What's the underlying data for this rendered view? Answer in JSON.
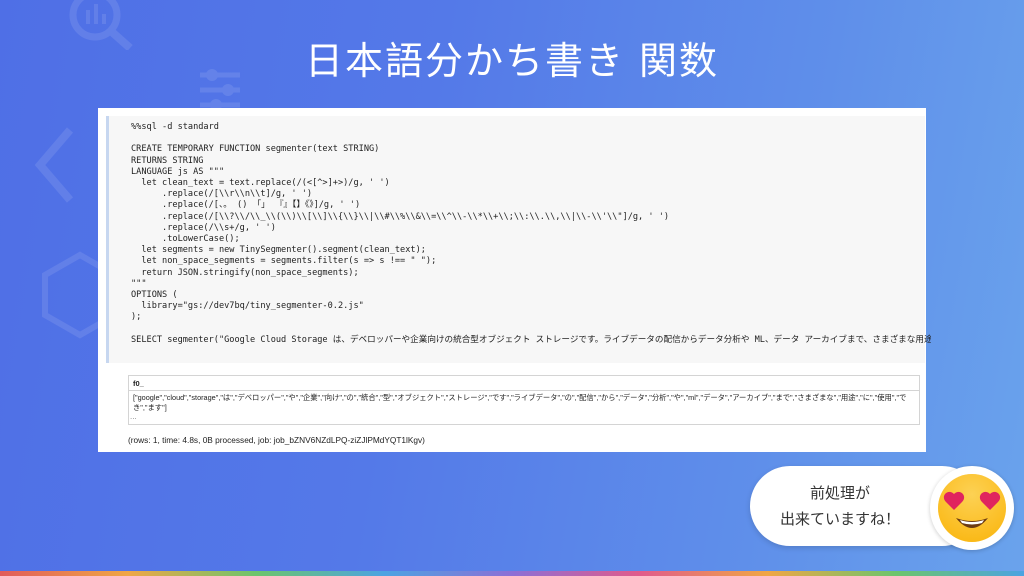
{
  "slide": {
    "title": "日本語分かち書き 関数"
  },
  "notebook": {
    "code_lines": [
      "%%sql -d standard",
      "",
      "CREATE TEMPORARY FUNCTION segmenter(text STRING)",
      "RETURNS STRING",
      "LANGUAGE js AS \"\"\"",
      "  let clean_text = text.replace(/(<[^>]+>)/g, ' ')",
      "      .replace(/[\\\\r\\\\n\\\\t]/g, ' ')",
      "      .replace(/[、。 () 「」 『』【】《》]/g, ' ')",
      "      .replace(/[\\\\?\\\\/\\\\_\\\\(\\\\)\\\\[\\\\]\\\\{\\\\}\\\\|\\\\#\\\\%\\\\&\\\\=\\\\^\\\\-\\\\*\\\\+\\\\;\\\\:\\\\.\\\\,\\\\|\\\\-\\\\'\\\\\"]/g, ' ')",
      "      .replace(/\\\\s+/g, ' ')",
      "      .toLowerCase();",
      "  let segments = new TinySegmenter().segment(clean_text);",
      "  let non_space_segments = segments.filter(s => s !== \" \");",
      "  return JSON.stringify(non_space_segments);",
      "\"\"\"",
      "OPTIONS (",
      "  library=\"gs://dev7bq/tiny_segmenter-0.2.js\"",
      ");",
      "",
      "SELECT segmenter(\"Google Cloud Storage は、デベロッパーや企業向けの統合型オブジェクト ストレージです。ライブデータの配信からデータ分析や ML、データ アーカイブまで、さまざまな用途に使用できま"
    ],
    "output": {
      "column_header": "f0_",
      "row_value": "[\"google\",\"cloud\",\"storage\",\"は\",\"デベロッパー\",\"や\",\"企業\",\"向け\",\"の\",\"統合\",\"型\",\"オブジェクト\",\"ストレージ\",\"です\",\"ライブデータ\",\"の\",\"配信\",\"から\",\"データ\",\"分析\",\"や\",\"ml\",\"データ\",\"アーカイブ\",\"まで\",\"さまざまな\",\"用途\",\"に\",\"使用\",\"で",
      "row_value_cont": "き\",\"ます\"]",
      "ellipsis": "...",
      "status": "(rows: 1, time: 4.8s, 0B processed, job: job_bZNV6NZdLPQ-ziZJlPMdYQT1lKgv)"
    }
  },
  "bubble": {
    "line1": "前処理が",
    "line2": "出来ていますね！"
  },
  "icons": {
    "emoji": "heart-eyes-emoji",
    "bg": [
      "magnifier-chart-icon",
      "settings-sliders-icon",
      "code-brackets-icon"
    ]
  },
  "colors": {
    "bg_start": "#4f6fe6",
    "bg_end": "#6aa3ec",
    "string_literal": "#b5273a"
  }
}
